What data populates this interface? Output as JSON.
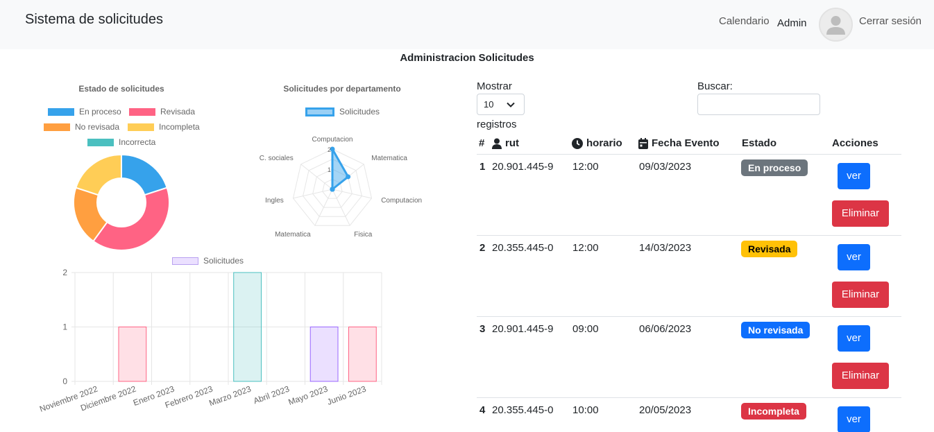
{
  "navbar": {
    "brand": "Sistema de solicitudes",
    "calendar_link": "Calendario",
    "admin_label": "Admin",
    "logout_link": "Cerrar sesión"
  },
  "page_title": "Administracion Solicitudes",
  "charts": {
    "status": {
      "title": "Estado de solicitudes",
      "legend": [
        {
          "label": "En proceso",
          "color": "#36a2eb"
        },
        {
          "label": "Revisada",
          "color": "#ff6384"
        },
        {
          "label": "No revisada",
          "color": "#ff9f40"
        },
        {
          "label": "Incompleta",
          "color": "#ffcd56"
        },
        {
          "label": "Incorrecta",
          "color": "#4bc0c0"
        }
      ]
    },
    "department": {
      "title": "Solicitudes por departamento",
      "legend_label": "Solicitudes",
      "axis_labels": [
        "Computacion",
        "Matematica",
        "Computacion",
        "Fisica",
        "Matematica",
        "Ingles",
        "C. sociales"
      ]
    },
    "monthly": {
      "legend_label": "Solicitudes",
      "y_ticks": [
        "0",
        "1",
        "2"
      ],
      "x_labels": [
        "Noviembre 2022",
        "Diciembre 2022",
        "Enero 2023",
        "Febrero 2023",
        "Marzo 2023",
        "Abril 2023",
        "Mayo 2023",
        "Junio 2023"
      ]
    }
  },
  "chart_data": [
    {
      "type": "pie",
      "title": "Estado de solicitudes",
      "categories": [
        "En proceso",
        "Revisada",
        "No revisada",
        "Incompleta",
        "Incorrecta"
      ],
      "values": [
        1,
        2,
        1,
        1,
        0
      ],
      "colors": [
        "#36a2eb",
        "#ff6384",
        "#ff9f40",
        "#ffcd56",
        "#4bc0c0"
      ],
      "legend": "top"
    },
    {
      "type": "radar",
      "title": "Solicitudes por departamento",
      "categories": [
        "Computacion",
        "Matematica",
        "Computacion",
        "Fisica",
        "Matematica",
        "Ingles",
        "C. sociales"
      ],
      "series": [
        {
          "name": "Solicitudes",
          "values": [
            2,
            1,
            0,
            0,
            0,
            0,
            0
          ]
        }
      ],
      "color": "#36a2eb",
      "ylim": [
        0,
        2
      ],
      "legend": "top"
    },
    {
      "type": "bar",
      "title": "",
      "categories": [
        "Noviembre 2022",
        "Diciembre 2022",
        "Enero 2023",
        "Febrero 2023",
        "Marzo 2023",
        "Abril 2023",
        "Mayo 2023",
        "Junio 2023"
      ],
      "series": [
        {
          "name": "Solicitudes",
          "values": [
            0,
            1,
            0,
            0,
            2,
            0,
            1,
            1
          ]
        }
      ],
      "bar_colors": [
        "#ff6384",
        "#ff6384",
        "#4bc0c0",
        "#4bc0c0",
        "#4bc0c0",
        "#9966ff",
        "#9966ff",
        "#ff6384"
      ],
      "ylim": [
        0,
        2
      ],
      "grid": true,
      "legend": "top"
    }
  ],
  "table": {
    "length_label": "Mostrar",
    "length_value": "10",
    "length_suffix": "registros",
    "search_label": "Buscar:",
    "headers": {
      "num": "#",
      "rut": "rut",
      "horario": "horario",
      "fecha": "Fecha Evento",
      "estado": "Estado",
      "acciones": "Acciones"
    },
    "view_label": "ver",
    "delete_label": "Eliminar",
    "rows": [
      {
        "num": "1",
        "rut": "20.901.445-9",
        "horario": "12:00",
        "fecha": "09/03/2023",
        "estado": "En proceso",
        "badge_bg": "#6c757d",
        "badge_fg": "#ffffff"
      },
      {
        "num": "2",
        "rut": "20.355.445-0",
        "horario": "12:00",
        "fecha": "14/03/2023",
        "estado": "Revisada",
        "badge_bg": "#ffc107",
        "badge_fg": "#000000"
      },
      {
        "num": "3",
        "rut": "20.901.445-9",
        "horario": "09:00",
        "fecha": "06/06/2023",
        "estado": "No revisada",
        "badge_bg": "#0d6efd",
        "badge_fg": "#ffffff"
      },
      {
        "num": "4",
        "rut": "20.355.445-0",
        "horario": "10:00",
        "fecha": "20/05/2023",
        "estado": "Incompleta",
        "badge_bg": "#dc3545",
        "badge_fg": "#ffffff"
      }
    ]
  }
}
